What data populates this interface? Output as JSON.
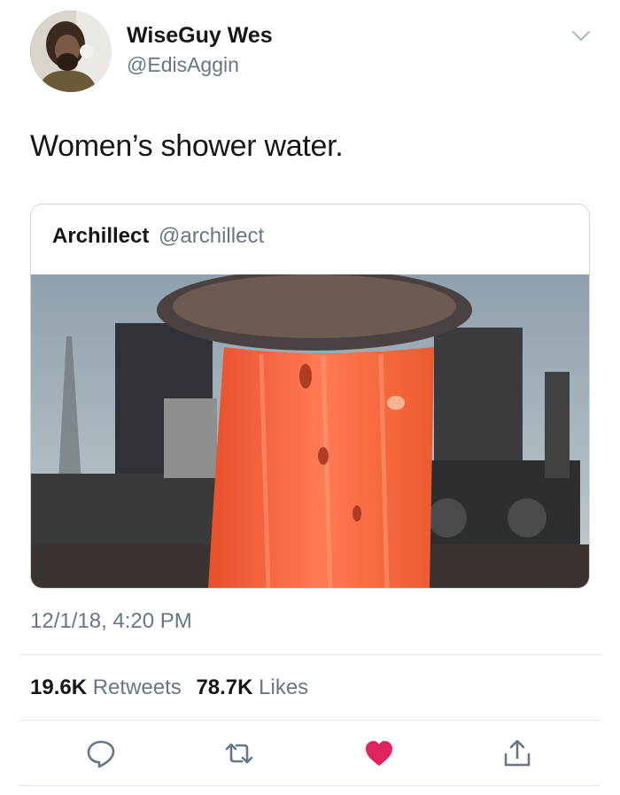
{
  "tweet": {
    "author": {
      "display_name": "WiseGuy Wes",
      "handle": "@EdisAggin"
    },
    "text": "Women’s shower water.",
    "timestamp": "12/1/18, 4:20 PM"
  },
  "quote": {
    "author": {
      "display_name": "Archillect",
      "handle": "@archillect"
    }
  },
  "stats": {
    "retweets_count": "19.6K",
    "retweets_label": "Retweets",
    "likes_count": "78.7K",
    "likes_label": "Likes"
  },
  "actions": {
    "reply_icon": "reply-icon",
    "retweet_icon": "retweet-icon",
    "like_icon": "heart-icon",
    "share_icon": "share-icon"
  },
  "colors": {
    "like_active": "#e0245e",
    "secondary_text": "#657786",
    "primary_text": "#14171a",
    "border": "#ccd6dd"
  }
}
